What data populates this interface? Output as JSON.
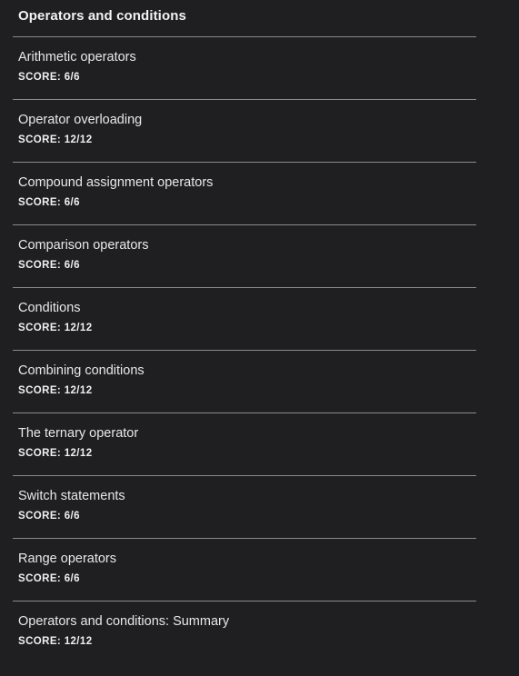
{
  "section": {
    "title": "Operators and conditions"
  },
  "items": [
    {
      "title": "Arithmetic operators",
      "score": "SCORE: 6/6"
    },
    {
      "title": "Operator overloading",
      "score": "SCORE: 12/12"
    },
    {
      "title": "Compound assignment operators",
      "score": "SCORE: 6/6"
    },
    {
      "title": "Comparison operators",
      "score": "SCORE: 6/6"
    },
    {
      "title": "Conditions",
      "score": "SCORE: 12/12"
    },
    {
      "title": "Combining conditions",
      "score": "SCORE: 12/12"
    },
    {
      "title": "The ternary operator",
      "score": "SCORE: 12/12"
    },
    {
      "title": "Switch statements",
      "score": "SCORE: 6/6"
    },
    {
      "title": "Range operators",
      "score": "SCORE: 6/6"
    },
    {
      "title": "Operators and conditions: Summary",
      "score": "SCORE: 12/12"
    }
  ]
}
